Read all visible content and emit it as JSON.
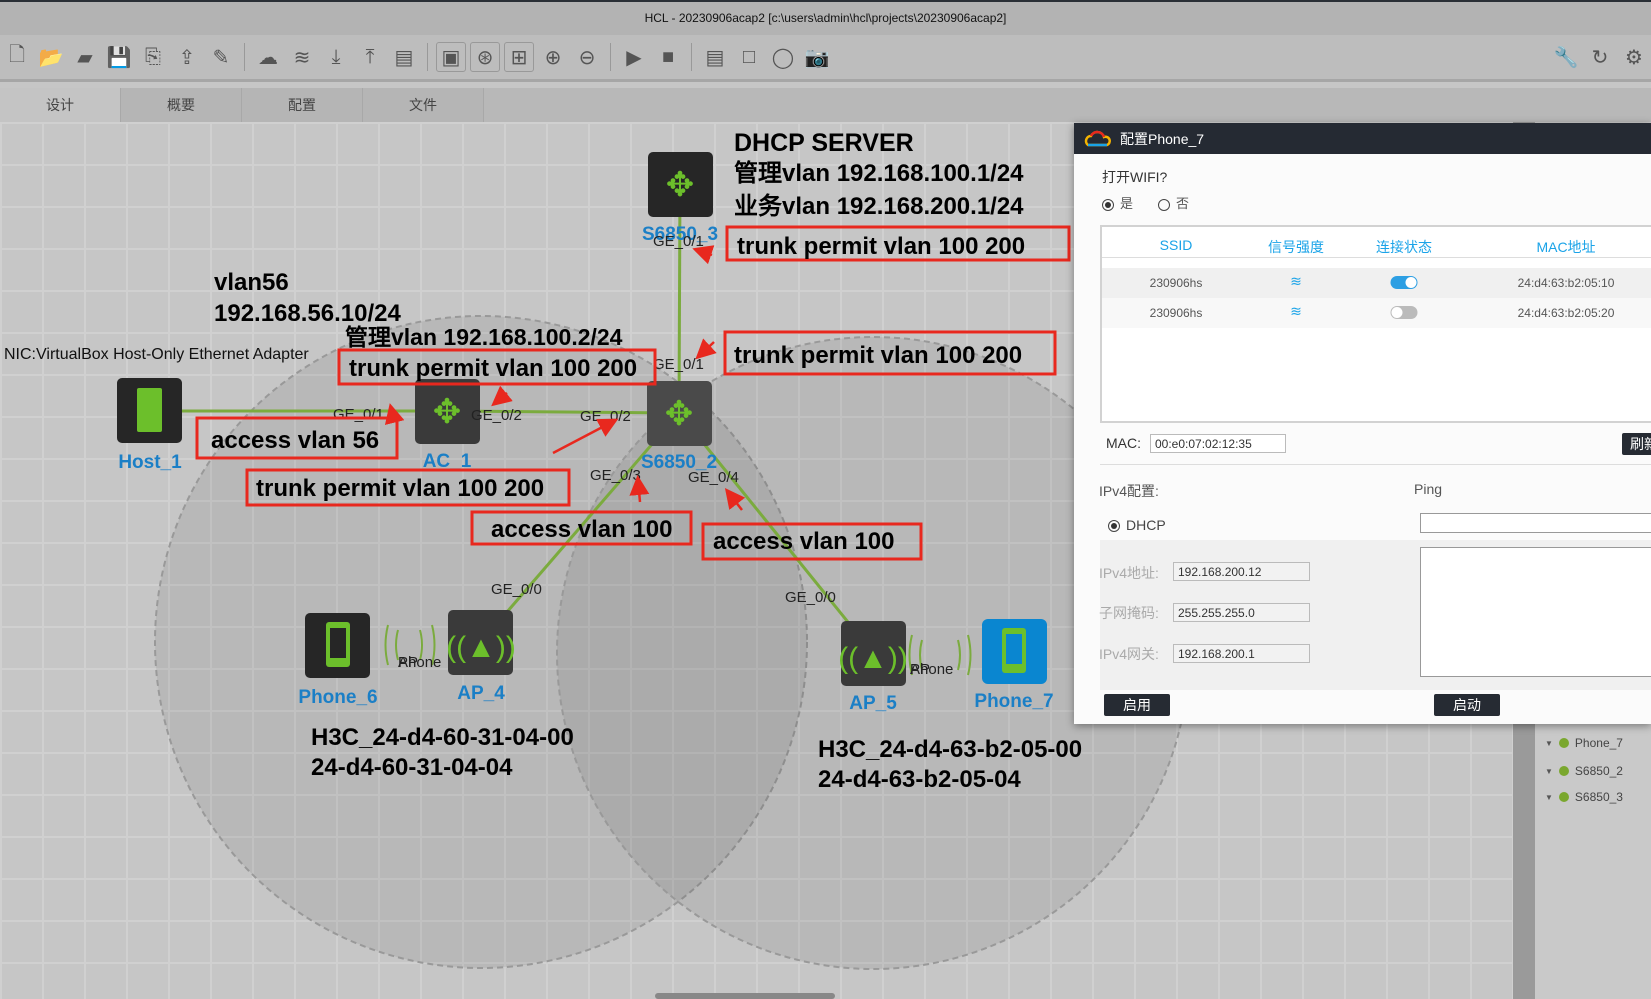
{
  "window": {
    "title": "HCL - 20230906acap2 [c:\\users\\admin\\hcl\\projects\\20230906acap2]"
  },
  "toolbar": {
    "icons": [
      "new-topology-icon",
      "open-icon",
      "folder-icon",
      "save-icon",
      "save-as-icon",
      "export-icon",
      "edit-icon",
      "cloud-icon",
      "layers-icon",
      "download-icon",
      "upload-icon",
      "log-icon",
      "show-interface-icon",
      "show-grid-icon",
      "layout-icon",
      "zoom-in-icon",
      "zoom-out-icon",
      "start-icon",
      "stop-icon",
      "add-text-icon",
      "add-rect-icon",
      "add-ellipse-icon",
      "screenshot-icon",
      "tools-icon",
      "refresh-icon",
      "settings-icon"
    ]
  },
  "tabs": [
    {
      "label": "设计"
    },
    {
      "label": "概要"
    },
    {
      "label": "配置"
    },
    {
      "label": "文件"
    }
  ],
  "topology": {
    "devices": {
      "s6850_3": "S6850_3",
      "s6850_2": "S6850_2",
      "ac_1": "AC_1",
      "host_1": "Host_1",
      "phone_6": "Phone_6",
      "ap_4": "AP_4",
      "ap_5": "AP_5",
      "phone_7": "Phone_7"
    },
    "ports": {
      "s3_ge01": "GE_0/1",
      "s2_ge01": "GE_0/1",
      "ac_ge01": "GE_0/1",
      "ac_ge02": "GE_0/2",
      "s2_ge02": "GE_0/2",
      "s2_ge03": "GE_0/3",
      "s2_ge04": "GE_0/4",
      "ap4_ge00": "GE_0/0",
      "ap5_ge00": "GE_0/0",
      "ap4_wl": "AP",
      "phone6_wl": "Phone",
      "ap5_wl": "AP",
      "phone7_wl": "Phone"
    },
    "annotations": {
      "dhcp_title": "DHCP SERVER",
      "dhcp_mgmt": "管理vlan 192.168.100.1/24",
      "dhcp_svc": "业务vlan 192.168.200.1/24",
      "vlan56": "vlan56",
      "vlan56_ip": "192.168.56.10/24",
      "ac_mgmt": "管理vlan 192.168.100.2/24",
      "nic": "NIC:VirtualBox Host-Only Ethernet Adapter",
      "ap4_name": "H3C_24-d4-60-31-04-00",
      "ap4_mac": "24-d4-60-31-04-04",
      "ap5_name": "H3C_24-d4-63-b2-05-00",
      "ap5_mac": "24-d4-63-b2-05-04"
    },
    "boxes": {
      "s3_trunk": "trunk permit vlan 100 200",
      "ac_trunk_top": "trunk permit vlan 100 200",
      "s2_trunk_top": "trunk permit vlan 100 200",
      "access56": "access vlan 56",
      "ac_trunk_bottom": "trunk permit vlan 100 200",
      "access100_left": "access vlan 100",
      "access100_right": "access vlan 100"
    }
  },
  "tree": {
    "items": [
      {
        "label": "Phone_7"
      },
      {
        "label": "S6850_2"
      },
      {
        "label": "S6850_3"
      }
    ]
  },
  "dialog": {
    "title": "配置Phone_7",
    "wifi_question": "打开WIFI?",
    "yes": "是",
    "no": "否",
    "columns": [
      "SSID",
      "信号强度",
      "连接状态",
      "MAC地址"
    ],
    "rows": [
      {
        "ssid": "230906hs",
        "connected": true,
        "mac": "24:d4:63:b2:05:10"
      },
      {
        "ssid": "230906hs",
        "connected": false,
        "mac": "24:d4:63:b2:05:20"
      }
    ],
    "mac_label": "MAC:",
    "mac_value": "00:e0:07:02:12:35",
    "refresh_label": "刷新",
    "ipv4_label": "IPv4配置:",
    "dhcp_label": "DHCP",
    "ipv4_addr_label": "IPv4地址:",
    "ipv4_addr": "192.168.200.12",
    "mask_label": "子网掩码:",
    "mask": "255.255.255.0",
    "gw_label": "IPv4网关:",
    "gw": "192.168.200.1",
    "enable_btn": "启用",
    "ping_label": "Ping",
    "ping_input": "",
    "start_btn": "启动"
  },
  "colors": {
    "link": "#7bab3e",
    "annotation_box": "#e8281e",
    "device_label": "#1b7fc6",
    "accent": "#1aa3e8"
  }
}
